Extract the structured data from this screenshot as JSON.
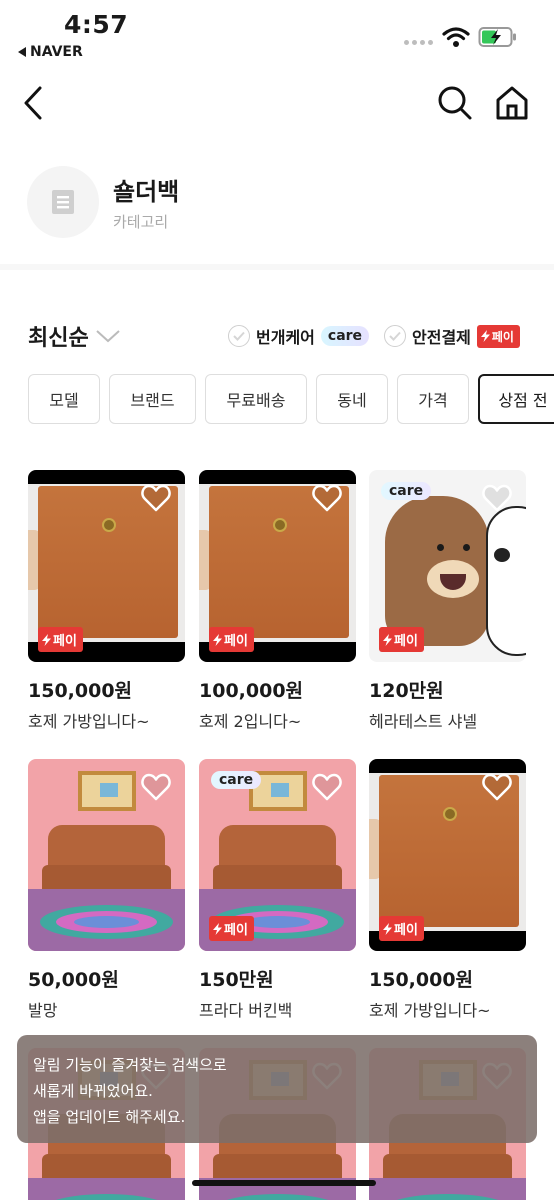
{
  "status_bar": {
    "time": "4:57",
    "back_app": "NAVER"
  },
  "category": {
    "title": "숄더백",
    "subtitle": "카테고리"
  },
  "sort": {
    "label": "최신순"
  },
  "options": [
    {
      "label": "번개케어",
      "badge": "care"
    },
    {
      "label": "안전결제",
      "badge": "페이"
    }
  ],
  "filters": [
    "모델",
    "브랜드",
    "무료배송",
    "동네",
    "가격",
    "상점 전"
  ],
  "badge_text": {
    "care": "care",
    "pay": "페이"
  },
  "products": [
    {
      "price": "150,000원",
      "name": "호제 가방입니다~",
      "image": "bag",
      "care": false,
      "pay": true
    },
    {
      "price": "100,000원",
      "name": "호제 2입니다~",
      "image": "bag",
      "care": false,
      "pay": true
    },
    {
      "price": "120만원",
      "name": "헤라테스트 샤넬",
      "image": "bear",
      "care": true,
      "pay": true
    },
    {
      "price": "50,000원",
      "name": "발망",
      "image": "room",
      "care": false,
      "pay": false
    },
    {
      "price": "150만원",
      "name": "프라다 버킨백",
      "image": "room",
      "care": true,
      "pay": true
    },
    {
      "price": "150,000원",
      "name": "호제 가방입니다~",
      "image": "bag",
      "care": false,
      "pay": true
    }
  ],
  "toast": {
    "line1": "알림 기능이 즐겨찾는 검색으로",
    "line2": "새롭게 바뀌었어요.",
    "line3": "앱을 업데이트 해주세요."
  },
  "colors": {
    "pay_red": "#e53935",
    "toast_bg": "#7c6e6a"
  }
}
